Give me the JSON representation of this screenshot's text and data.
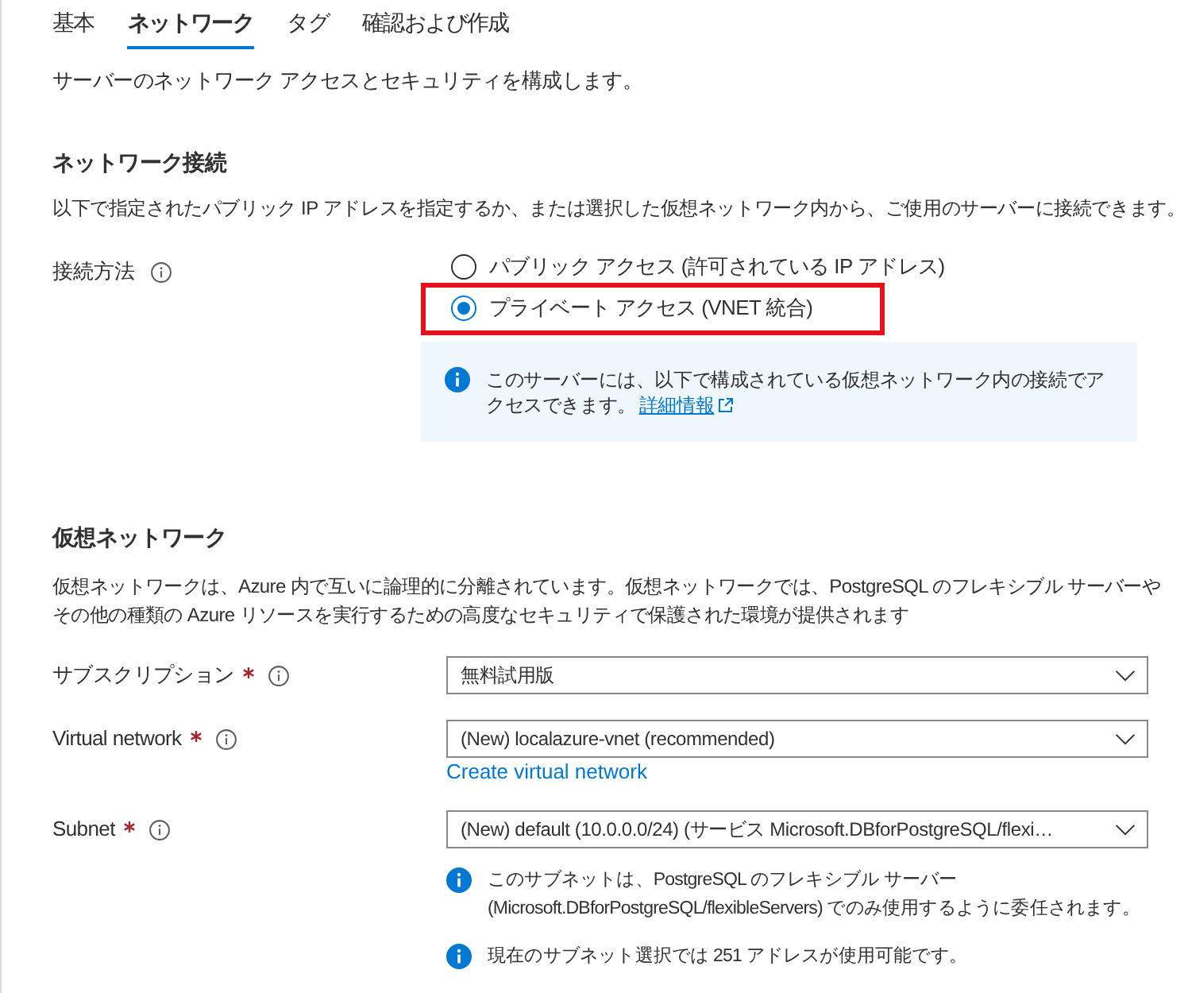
{
  "tabs": [
    {
      "label": "基本",
      "selected": false
    },
    {
      "label": "ネットワーク",
      "selected": true
    },
    {
      "label": "タグ",
      "selected": false
    },
    {
      "label": "確認および作成",
      "selected": false
    }
  ],
  "intro": "サーバーのネットワーク アクセスとセキュリティを構成します。",
  "network_connectivity": {
    "heading": "ネットワーク接続",
    "description": "以下で指定されたパブリック IP アドレスを指定するか、または選択した仮想ネットワーク内から、ご使用のサーバーに接続できます。",
    "method": {
      "label": "接続方法",
      "options": [
        {
          "label": "パブリック アクセス (許可されている IP アドレス)",
          "selected": false,
          "highlighted": false
        },
        {
          "label": "プライベート アクセス (VNET 統合)",
          "selected": true,
          "highlighted": true
        }
      ],
      "info": {
        "text": "このサーバーには、以下で構成されている仮想ネットワーク内の接続でアクセスできます。",
        "link": "詳細情報"
      }
    }
  },
  "virtual_network": {
    "heading": "仮想ネットワーク",
    "description": "仮想ネットワークは、Azure 内で互いに論理的に分離されています。仮想ネットワークでは、PostgreSQL のフレキシブル サーバーやその他の種類の Azure リソースを実行するための高度なセキュリティで保護された環境が提供されます",
    "fields": [
      {
        "label": "サブスクリプション",
        "required": true,
        "value": "無料試用版"
      },
      {
        "label": "Virtual network",
        "required": true,
        "value": "(New) localazure-vnet (recommended)",
        "link": "Create virtual network"
      },
      {
        "label": "Subnet",
        "required": true,
        "value": "(New) default (10.0.0.0/24) (サービス Microsoft.DBforPostgreSQL/flexi…",
        "notes": [
          "このサブネットは、PostgreSQL のフレキシブル サーバー (Microsoft.DBforPostgreSQL/flexibleServers) でのみ使用するように委任されます。",
          "現在のサブネット選択では 251 アドレスが使用可能です。"
        ]
      }
    ]
  }
}
